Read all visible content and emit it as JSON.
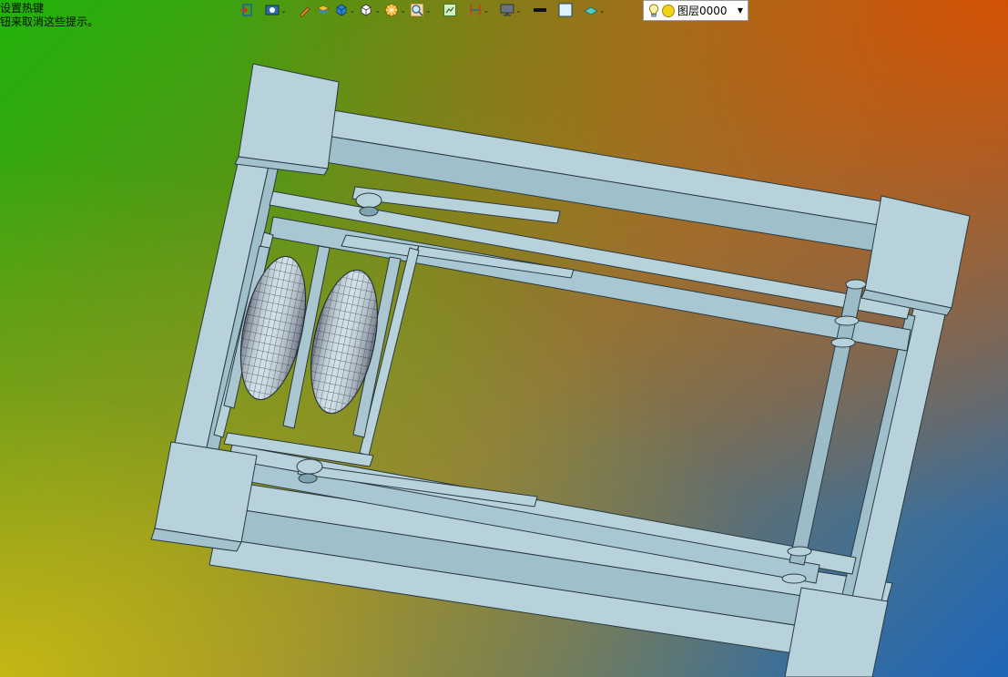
{
  "hint": {
    "line1": "设置热键",
    "line2": "钮来取消这些提示。"
  },
  "toolbar": {
    "items": [
      {
        "icon": "exit-sketch-icon",
        "dropdown": false
      },
      {
        "icon": "view-orientation-icon",
        "dropdown": true
      },
      {
        "icon": "pencil-icon",
        "dropdown": false
      },
      {
        "icon": "layer-stack-icon",
        "dropdown": false
      },
      {
        "icon": "display-style-icon",
        "dropdown": true
      },
      {
        "icon": "hide-show-icon",
        "dropdown": true
      },
      {
        "icon": "appearance-icon",
        "dropdown": true
      },
      {
        "icon": "zoom-icon",
        "dropdown": true
      },
      {
        "icon": "section-view-icon",
        "dropdown": false
      },
      {
        "icon": "dimension-icon",
        "dropdown": true
      },
      {
        "icon": "monitor-icon",
        "dropdown": true
      },
      {
        "icon": "line-color-icon",
        "dropdown": false
      },
      {
        "icon": "fill-color-icon",
        "dropdown": false
      },
      {
        "icon": "line-style-icon",
        "dropdown": true
      }
    ]
  },
  "layer": {
    "name": "图层0000"
  },
  "colors": {
    "part_fill": "#b8d2dc",
    "part_edge": "#2a3a40",
    "part_shade": "#8fb0bd"
  }
}
